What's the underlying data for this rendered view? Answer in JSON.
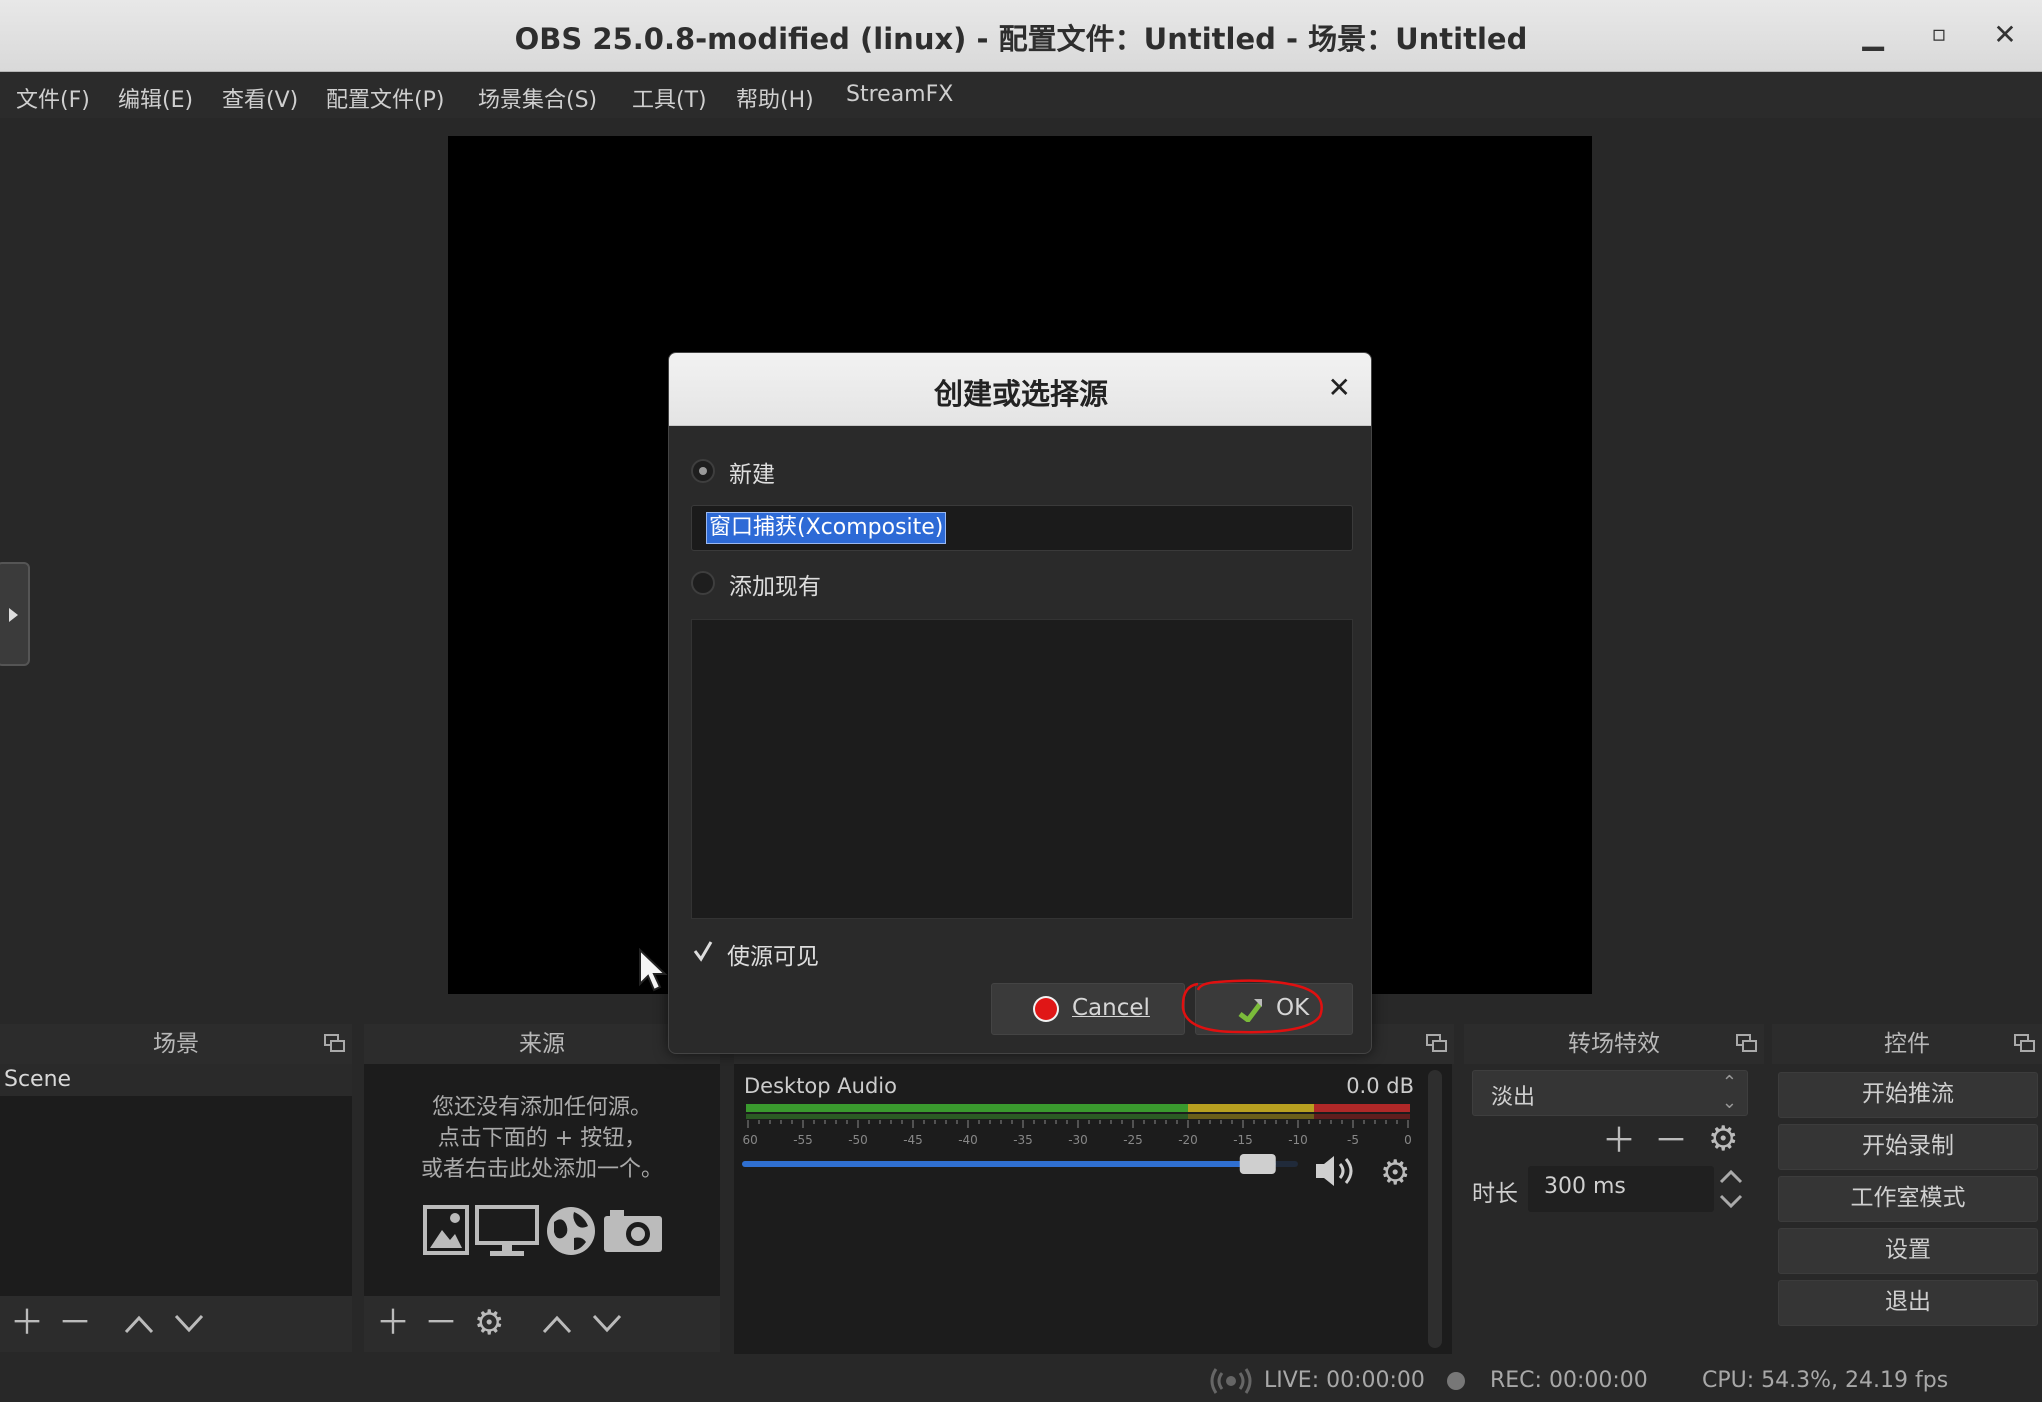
{
  "window": {
    "title": "OBS 25.0.8-modified (linux) - 配置文件：Untitled - 场景：Untitled",
    "minimize_glyph": "▁",
    "maximize_glyph": "▫",
    "close_glyph": "✕"
  },
  "menu": [
    "文件(F)",
    "编辑(E)",
    "查看(V)",
    "配置文件(P)",
    "场景集合(S)",
    "工具(T)",
    "帮助(H)",
    "StreamFX"
  ],
  "scenes": {
    "title": "场景",
    "items": [
      "Scene"
    ]
  },
  "sources": {
    "title": "来源",
    "empty_line1": "您还没有添加任何源。",
    "empty_line2": "点击下面的 + 按钮，",
    "empty_line3": "或者右击此处添加一个。",
    "icons": [
      "image-icon",
      "display-icon",
      "globe-icon",
      "camera-icon"
    ]
  },
  "mixer": {
    "channel_name": "Desktop Audio",
    "level": "0.0 dB",
    "scale": [
      "-60",
      "-55",
      "-50",
      "-45",
      "-40",
      "-35",
      "-30",
      "-25",
      "-20",
      "-15",
      "-10",
      "-5",
      "0"
    ],
    "volume_fraction": 0.96
  },
  "transitions": {
    "title": "转场特效",
    "selected": "淡出",
    "duration_label": "时长",
    "duration_value": "300 ms"
  },
  "controls": {
    "title": "控件",
    "buttons": [
      "开始推流",
      "开始录制",
      "工作室模式",
      "设置",
      "退出"
    ]
  },
  "status": {
    "live": "LIVE: 00:00:00",
    "rec": "REC: 00:00:00",
    "cpu": "CPU: 54.3%, 24.19 fps"
  },
  "dialog": {
    "title": "创建或选择源",
    "close_glyph": "✕",
    "new_label": "新建",
    "name_value": "窗口捕获(Xcomposite)",
    "existing_label": "添加现有",
    "visible_label": "使源可见",
    "cancel_label": "Cancel",
    "ok_label": "OK"
  },
  "colors": {
    "accent_selection": "#2d6ad6",
    "meter_green": "#3a9a2e",
    "meter_yellow": "#b8a020",
    "meter_red": "#b02828",
    "volume_blue": "#2f6fd0",
    "annotation_red": "#e01010"
  }
}
